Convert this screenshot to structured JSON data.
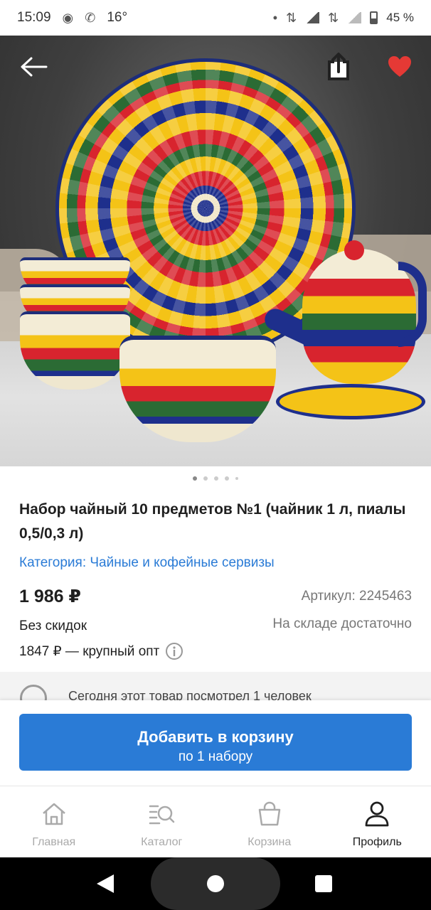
{
  "status_bar": {
    "time": "15:09",
    "temperature": "16°",
    "battery": "45 %"
  },
  "product": {
    "title": "Набор чайный 10 предметов №1 (чайник 1 л, пиалы 0,5/0,3 л)",
    "category": "Категория: Чайные и кофейные сервизы",
    "price": "1 986 ₽",
    "sku": "Артикул: 2245463",
    "discount": "Без скидок",
    "stock": "На складе достаточно",
    "wholesale": "1847 ₽ — крупный опт",
    "viewed": "Сегодня этот товар посмотрел 1 человек",
    "favorite_color": "#e53935"
  },
  "gallery": {
    "slides": 5,
    "active_index": 0
  },
  "cart": {
    "add_label": "Добавить в корзину",
    "add_sublabel": "по 1 набору",
    "button_color": "#2a7bd6"
  },
  "nav": {
    "items": [
      {
        "label": "Главная",
        "icon": "home-icon"
      },
      {
        "label": "Каталог",
        "icon": "catalog-search-icon"
      },
      {
        "label": "Корзина",
        "icon": "basket-icon"
      },
      {
        "label": "Профиль",
        "icon": "profile-icon"
      }
    ],
    "active": "Профиль"
  }
}
